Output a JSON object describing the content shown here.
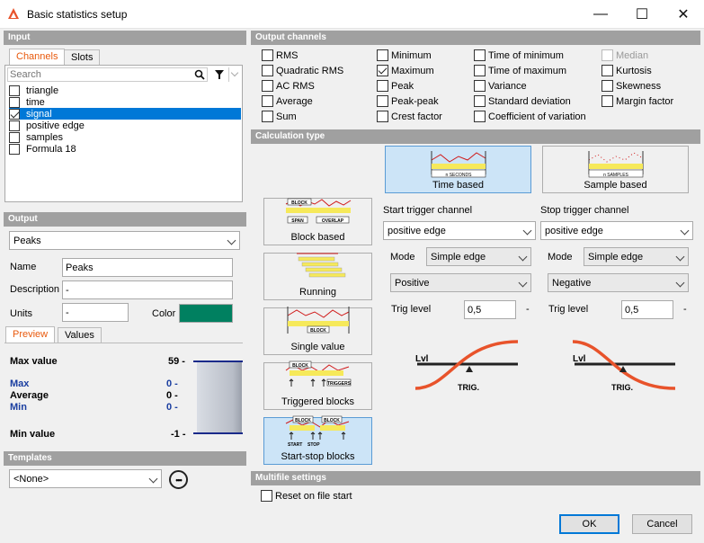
{
  "window": {
    "title": "Basic statistics setup",
    "min_symbol": "—",
    "max_symbol": "☐",
    "close_symbol": "✕"
  },
  "input": {
    "header": "Input",
    "tabs": [
      "Channels",
      "Slots"
    ],
    "search_placeholder": "Search",
    "channels": [
      {
        "label": "triangle",
        "checked": false
      },
      {
        "label": "time",
        "checked": false
      },
      {
        "label": "signal",
        "checked": true
      },
      {
        "label": "positive edge",
        "checked": false
      },
      {
        "label": "samples",
        "checked": false
      },
      {
        "label": "Formula 18",
        "checked": false
      }
    ]
  },
  "output": {
    "header": "Output",
    "selected": "Peaks",
    "name_label": "Name",
    "name_value": "Peaks",
    "description_label": "Description",
    "description_value": "-",
    "units_label": "Units",
    "units_value": "-",
    "color_label": "Color",
    "color_value": "#008060",
    "tabs": [
      "Preview",
      "Values"
    ],
    "max_value_label": "Max value",
    "max_value": "59 -",
    "max_label": "Max",
    "max_val": "0 -",
    "avg_label": "Average",
    "avg_val": "0 -",
    "min_label": "Min",
    "min_val": "0 -",
    "min_value_label": "Min value",
    "min_value": "-1 -"
  },
  "templates": {
    "header": "Templates",
    "selected": "<None>",
    "more_symbol": "•••"
  },
  "output_channels": {
    "header": "Output channels",
    "items": [
      {
        "label": "RMS",
        "checked": false,
        "disabled": false
      },
      {
        "label": "Quadratic RMS",
        "checked": false,
        "disabled": false
      },
      {
        "label": "AC RMS",
        "checked": false,
        "disabled": false
      },
      {
        "label": "Average",
        "checked": false,
        "disabled": false
      },
      {
        "label": "Sum",
        "checked": false,
        "disabled": false
      },
      {
        "label": "Minimum",
        "checked": false,
        "disabled": false
      },
      {
        "label": "Maximum",
        "checked": true,
        "disabled": false
      },
      {
        "label": "Peak",
        "checked": false,
        "disabled": false
      },
      {
        "label": "Peak-peak",
        "checked": false,
        "disabled": false
      },
      {
        "label": "Crest factor",
        "checked": false,
        "disabled": false
      },
      {
        "label": "Time of minimum",
        "checked": false,
        "disabled": false
      },
      {
        "label": "Time of maximum",
        "checked": false,
        "disabled": false
      },
      {
        "label": "Variance",
        "checked": false,
        "disabled": false
      },
      {
        "label": "Standard deviation",
        "checked": false,
        "disabled": false
      },
      {
        "label": "Coefficient of variation",
        "checked": false,
        "disabled": false
      },
      {
        "label": "Median",
        "checked": false,
        "disabled": true
      },
      {
        "label": "Kurtosis",
        "checked": false,
        "disabled": false
      },
      {
        "label": "Skewness",
        "checked": false,
        "disabled": false
      },
      {
        "label": "Margin factor",
        "checked": false,
        "disabled": false
      }
    ]
  },
  "calc": {
    "header": "Calculation type",
    "time_based": "Time based",
    "time_based_caption": "n SECONDS",
    "sample_based": "Sample based",
    "sample_based_caption": "n SAMPLES",
    "modes": [
      {
        "label": "Block based",
        "selected": false
      },
      {
        "label": "Running",
        "selected": false
      },
      {
        "label": "Single value",
        "selected": false
      },
      {
        "label": "Triggered blocks",
        "selected": false
      },
      {
        "label": "Start-stop blocks",
        "selected": true
      }
    ],
    "glyphs": {
      "block": "BLOCK",
      "span": "SPAN",
      "overlap": "OVERLAP",
      "triggers": "TRIGGERS",
      "start": "START",
      "stop": "STOP"
    },
    "start": {
      "title": "Start trigger channel",
      "channel": "positive edge",
      "mode_label": "Mode",
      "mode": "Simple edge",
      "direction": "Positive",
      "level_label": "Trig level",
      "level": "0,5",
      "unit": "-",
      "lvl": "Lvl",
      "trig": "TRIG."
    },
    "stop": {
      "title": "Stop trigger channel",
      "channel": "positive edge",
      "mode_label": "Mode",
      "mode": "Simple edge",
      "direction": "Negative",
      "level_label": "Trig level",
      "level": "0,5",
      "unit": "-",
      "lvl": "Lvl",
      "trig": "TRIG."
    }
  },
  "multifile": {
    "header": "Multifile settings",
    "reset_label": "Reset on file start",
    "reset_checked": false
  },
  "buttons": {
    "ok": "OK",
    "cancel": "Cancel"
  }
}
